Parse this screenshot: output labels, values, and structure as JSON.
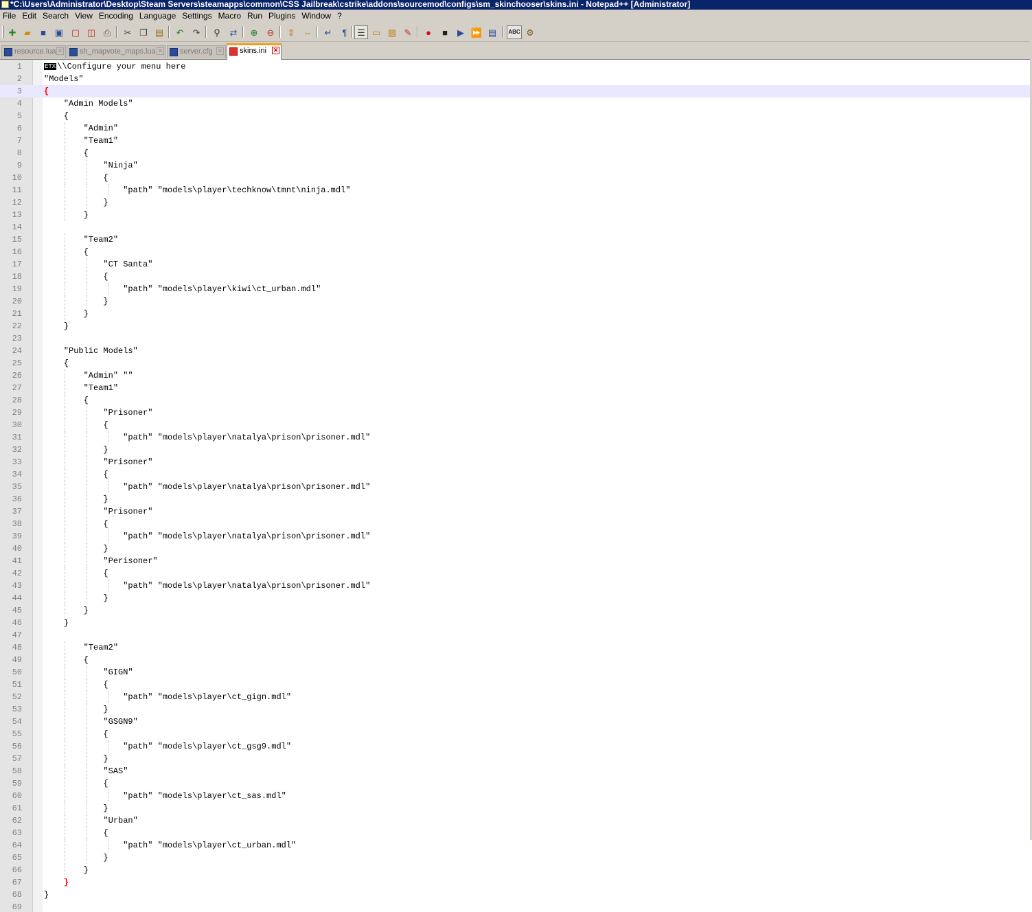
{
  "window": {
    "title": "*C:\\Users\\Administrator\\Desktop\\Steam Servers\\steamapps\\common\\CSS Jailbreak\\cstrike\\addons\\sourcemod\\configs\\sm_skinchooser\\skins.ini - Notepad++ [Administrator]"
  },
  "menu": [
    "File",
    "Edit",
    "Search",
    "View",
    "Encoding",
    "Language",
    "Settings",
    "Macro",
    "Run",
    "Plugins",
    "Window",
    "?"
  ],
  "tabs": [
    {
      "label": "resource.lua",
      "active": false
    },
    {
      "label": "sh_mapvote_maps.lua",
      "active": false
    },
    {
      "label": "server.cfg",
      "active": false
    },
    {
      "label": "skins.ini",
      "active": true
    }
  ],
  "editor": {
    "etx_marker": "ETX",
    "current_line": 3,
    "lines": [
      "\\\\Configure your menu here",
      "\"Models\"",
      "{",
      "    \"Admin Models\"",
      "    {",
      "        \"Admin\"",
      "        \"Team1\"",
      "        {",
      "            \"Ninja\"",
      "            {",
      "                \"path\" \"models\\player\\techknow\\tmnt\\ninja.mdl\"",
      "            }",
      "        }",
      "",
      "        \"Team2\"",
      "        {",
      "            \"CT Santa\"",
      "            {",
      "                \"path\" \"models\\player\\kiwi\\ct_urban.mdl\"",
      "            }",
      "        }",
      "    }",
      "",
      "    \"Public Models\"",
      "    {",
      "        \"Admin\" \"\"",
      "        \"Team1\"",
      "        {",
      "            \"Prisoner\"",
      "            {",
      "                \"path\" \"models\\player\\natalya\\prison\\prisoner.mdl\"",
      "            }",
      "            \"Prisoner\"",
      "            {",
      "                \"path\" \"models\\player\\natalya\\prison\\prisoner.mdl\"",
      "            }",
      "            \"Prisoner\"",
      "            {",
      "                \"path\" \"models\\player\\natalya\\prison\\prisoner.mdl\"",
      "            }",
      "            \"Perisoner\"",
      "            {",
      "                \"path\" \"models\\player\\natalya\\prison\\prisoner.mdl\"",
      "            }",
      "        }",
      "    }",
      "",
      "        \"Team2\"",
      "        {",
      "            \"GIGN\"",
      "            {",
      "                \"path\" \"models\\player\\ct_gign.mdl\"",
      "            }",
      "            \"GSGN9\"",
      "            {",
      "                \"path\" \"models\\player\\ct_gsg9.mdl\"",
      "            }",
      "            \"SAS\"",
      "            {",
      "                \"path\" \"models\\player\\ct_sas.mdl\"",
      "            }",
      "            \"Urban\"",
      "            {",
      "                \"path\" \"models\\player\\ct_urban.mdl\"",
      "            }",
      "        }",
      "    }",
      "}",
      ""
    ]
  },
  "colors": {
    "titlebar": "#0a246a",
    "chrome": "#d4d0c8",
    "current_line": "#e8e8ff",
    "brace_match": "#ff0000",
    "active_tab_accent": "#f0a020"
  }
}
